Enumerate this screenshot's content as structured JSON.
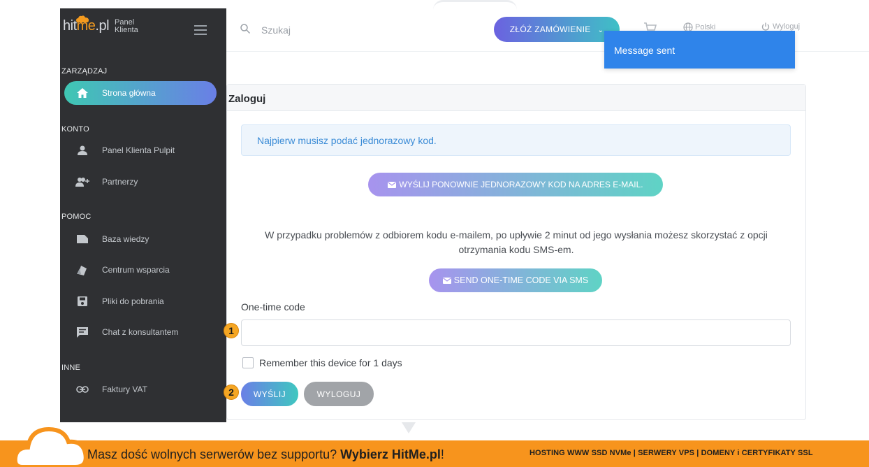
{
  "brand": {
    "name_part1": "hit",
    "name_part2": "me",
    "name_part3": ".pl",
    "sub1": "Panel",
    "sub2": "Klienta"
  },
  "sidebar": {
    "sections": [
      {
        "title": "ZARZĄDZAJ",
        "items": [
          {
            "label": "Strona główna",
            "icon": "home-icon",
            "active": true
          }
        ]
      },
      {
        "title": "KONTO",
        "items": [
          {
            "label": "Panel Klienta Pulpit",
            "icon": "user-icon"
          },
          {
            "label": "Partnerzy",
            "icon": "partners-icon"
          }
        ]
      },
      {
        "title": "POMOC",
        "items": [
          {
            "label": "Baza wiedzy",
            "icon": "folder-icon"
          },
          {
            "label": "Centrum wsparcia",
            "icon": "tickets-icon"
          },
          {
            "label": "Pliki do pobrania",
            "icon": "save-icon"
          },
          {
            "label": "Chat z konsultantem",
            "icon": "chat-icon"
          }
        ]
      },
      {
        "title": "INNE",
        "items": [
          {
            "label": "Faktury VAT",
            "icon": "link-icon"
          }
        ]
      }
    ]
  },
  "topbar": {
    "search_placeholder": "Szukaj",
    "order_label": "ZŁÓŻ ZAMÓWIENIE",
    "language": "Polski",
    "logout": "Wyloguj"
  },
  "toast": {
    "message": "Message sent"
  },
  "card": {
    "title": "Zaloguj",
    "info": "Najpierw musisz podać jednorazowy kod.",
    "resend_label": "WYŚLIJ PONOWNIE JEDNORAZOWY KOD NA ADRES E-MAIL.",
    "problem_text": "W przypadku problemów z odbiorem kodu e-mailem, po upływie 2 minut od jego wysłania możesz skorzystać z opcji otrzymania kodu SMS-em.",
    "sms_label": "SEND ONE-TIME CODE VIA SMS",
    "otc_label": "One-time code",
    "otc_value": "",
    "remember_label": "Remember this device for 1 days",
    "send_label": "WYŚLIJ",
    "logout_label": "WYLOGUJ"
  },
  "markers": {
    "m1": "1",
    "m2": "2"
  },
  "banner": {
    "text_plain": "Masz dość wolnych serwerów bez supportu? ",
    "text_bold": "Wybierz HitMe.pl",
    "text_end": "!",
    "right": "HOSTING WWW SSD NVMe | SERWERY VPS | DOMENY i CERTYFIKATY SSL"
  },
  "colors": {
    "accent_orange": "#f7941d",
    "sidebar_bg": "#2f3033",
    "toast_blue": "#2f84ea",
    "info_blue": "#3a8bd6"
  }
}
